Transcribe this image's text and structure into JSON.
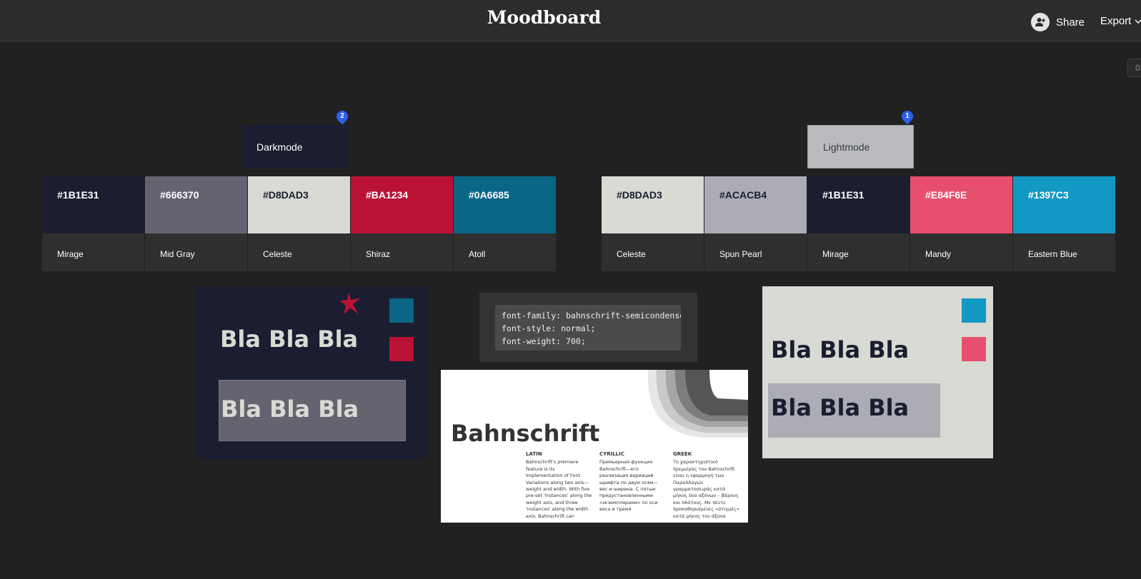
{
  "header": {
    "title": "Moodboard",
    "share_label": "Share",
    "export_label": "Export",
    "zoom_partial": "0"
  },
  "dark_group": {
    "label": "Darkmode",
    "pin": "2",
    "swatches": [
      {
        "hex": "#1B1E31",
        "name": "Mirage",
        "color": "#1b1e31",
        "text_color": "#ffffff"
      },
      {
        "hex": "#666370",
        "name": "Mid Gray",
        "color": "#666370",
        "text_color": "#ffffff"
      },
      {
        "hex": "#D8DAD3",
        "name": "Celeste",
        "color": "#d8dad3",
        "text_color": "#1b1e31"
      },
      {
        "hex": "#BA1234",
        "name": "Shiraz",
        "color": "#ba1234",
        "text_color": "#ffffff"
      },
      {
        "hex": "#0A6685",
        "name": "Atoll",
        "color": "#0a6685",
        "text_color": "#ffffff"
      }
    ]
  },
  "light_group": {
    "label": "Lightmode",
    "pin": "1",
    "swatches": [
      {
        "hex": "#D8DAD3",
        "name": "Celeste",
        "color": "#d8dad3",
        "text_color": "#1b1e31"
      },
      {
        "hex": "#ACACB4",
        "name": "Spun Pearl",
        "color": "#acacb4",
        "text_color": "#1b1e31"
      },
      {
        "hex": "#1B1E31",
        "name": "Mirage",
        "color": "#1b1e31",
        "text_color": "#ffffff"
      },
      {
        "hex": "#E84F6E",
        "name": "Mandy",
        "color": "#e84f6e",
        "text_color": "#ffffff"
      },
      {
        "hex": "#1397C3",
        "name": "Eastern Blue",
        "color": "#1397c3",
        "text_color": "#ffffff"
      }
    ]
  },
  "dark_preview": {
    "text1": "Bla Bla Bla",
    "text2": "Bla Bla Bla"
  },
  "light_preview": {
    "text1": "Bla Bla Bla",
    "text2": "Bla Bla Bla"
  },
  "code": {
    "lines": [
      "font-family: bahnschrift-semicondensed;",
      "font-style: normal;",
      "font-weight: 700;"
    ]
  },
  "specimen": {
    "title": "Bahnschrift",
    "latin_head": "LATIN",
    "latin_text": "Bahnschrift's premiere feature is its implementation of Font Variations along two axis—weight and width. With five pre-set 'instances' along the weight axis, and three 'instances' along the width axis, Bahnschrift can",
    "cyrillic_head": "CYRILLIC",
    "cyrillic_text": "Премьерная функция Bahnschrift—его реализация вариаций шрифта по двум осям—вес и ширина. С пятью предустановленными «экземплярами» по оси веса и тремя",
    "greek_head": "GREEK",
    "greek_text": "Το χαρακτηριστικό πρεμιέρας του Bahnschrift είναι η εφαρμογή των Παραλλαγών γραμματοσειράς κατά μήκος δύο αξόνων – βάρους και πλάτους. Με πέντε προκαθορισμένες «στιγμές» κατά μήκος του άξονα"
  }
}
